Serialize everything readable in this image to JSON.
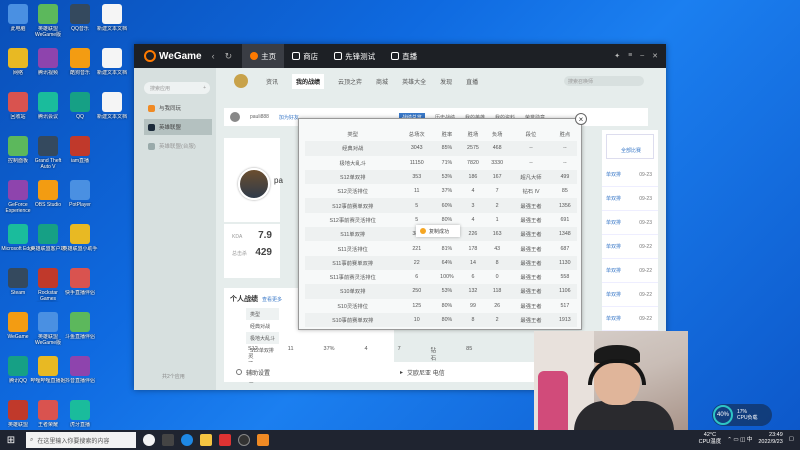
{
  "desktop": {
    "col1": [
      "此电脑",
      "网络",
      "回收站",
      "控制面板",
      "GeForce Experience",
      "Microsoft Edge",
      "Steam",
      "WeGame",
      "腾讯QQ",
      "英雄联盟"
    ],
    "col2": [
      "英雄联盟 WeGame版",
      "腾讯视频",
      "腾讯会议",
      "Grand Theft Auto V",
      "OBS Studio",
      "英雄联盟客户端",
      "Rockstar Games Launcher",
      "英雄联盟WeGame版",
      "哔哩哔哩直播姬",
      "王者荣耀"
    ],
    "col3": [
      "QQ音乐",
      "酷狗音乐",
      "QQ",
      "iam直播",
      "PotPlayer",
      "英雄联盟小助手",
      "快手直播伴侣",
      "斗鱼直播伴侣",
      "抖音直播伴侣",
      "虎牙直播"
    ],
    "col4": [
      "新建文本文档",
      "新建文本文档",
      "新建文本文档"
    ]
  },
  "wegame": {
    "logo": "WeGame",
    "nav": {
      "home": "主页",
      "store": "商店",
      "test": "先锋测试",
      "live": "直播"
    },
    "sidebar": {
      "search_placeholder": "搜索应用",
      "add": "+",
      "items": [
        "与我同玩",
        "英雄联盟",
        "英雄联盟(台服)"
      ],
      "footer": "共2个应用"
    },
    "game_tabs": [
      "资讯",
      "我的战绩",
      "云顶之弈",
      "商城",
      "英雄大全",
      "发现",
      "直播"
    ],
    "game_search_placeholder": "搜索召唤师",
    "sub_tabs": {
      "player": "pauli888",
      "fav": "加为好友",
      "items": [
        "战绩总览",
        "历史战绩",
        "我的英雄",
        "我的资料",
        "荣誉勋章"
      ]
    },
    "kda": [
      {
        "label": "KDA",
        "value": "7.9"
      },
      {
        "label": "总击杀",
        "value": "429"
      }
    ],
    "profile_name": "pa",
    "record": {
      "title": "个人战绩",
      "more": "查看更多",
      "header": "类型",
      "rows": [
        "经典对战",
        "极地大乱斗",
        "S12单双排"
      ],
      "last_row": [
        "S12灵活排位",
        "11",
        "37%",
        "4",
        "7",
        "钻石 IV",
        "85"
      ]
    },
    "rightlist": {
      "header": "全部比赛",
      "items": [
        {
          "mode": "单双排",
          "date": "09-23"
        },
        {
          "mode": "单双排",
          "date": "09-23"
        },
        {
          "mode": "单双排",
          "date": "09-23"
        },
        {
          "mode": "单双排",
          "date": "09-22"
        },
        {
          "mode": "单双排",
          "date": "09-22"
        },
        {
          "mode": "单双排",
          "date": "09-22"
        },
        {
          "mode": "单双排",
          "date": "09-22"
        },
        {
          "mode": "单双排",
          "date": "09-22"
        }
      ]
    },
    "footer": {
      "settings": "辅助设置",
      "voice": "艾欧尼亚 电信"
    }
  },
  "popup": {
    "columns": [
      "类型",
      "总场次",
      "胜率",
      "胜场",
      "负场",
      "段位",
      "胜点"
    ],
    "rows": [
      [
        "经典对战",
        "3043",
        "85%",
        "2575",
        "468",
        "--",
        "--"
      ],
      [
        "极地大乱斗",
        "11150",
        "71%",
        "7820",
        "3330",
        "--",
        "--"
      ],
      [
        "S12单双排",
        "353",
        "53%",
        "186",
        "167",
        "超凡大师",
        "499"
      ],
      [
        "S12灵活排位",
        "11",
        "37%",
        "4",
        "7",
        "钻石 IV",
        "85"
      ],
      [
        "S12事前赛单双排",
        "5",
        "60%",
        "3",
        "2",
        "最强王者",
        "1356"
      ],
      [
        "S12事前赛灵活排位",
        "5",
        "80%",
        "4",
        "1",
        "最强王者",
        "691"
      ],
      [
        "S11单双排",
        "389",
        "58%",
        "226",
        "163",
        "最强王者",
        "1348"
      ],
      [
        "S11灵活排位",
        "221",
        "81%",
        "178",
        "43",
        "最强王者",
        "687"
      ],
      [
        "S11事前赛单双排",
        "22",
        "64%",
        "14",
        "8",
        "最强王者",
        "1130"
      ],
      [
        "S11事前赛灵活排位",
        "6",
        "100%",
        "6",
        "0",
        "最强王者",
        "558"
      ],
      [
        "S10单双排",
        "250",
        "53%",
        "132",
        "118",
        "最强王者",
        "1106"
      ],
      [
        "S10灵活排位",
        "125",
        "80%",
        "99",
        "26",
        "最强王者",
        "517"
      ],
      [
        "S10事前赛单双排",
        "10",
        "80%",
        "8",
        "2",
        "最强王者",
        "1913"
      ]
    ],
    "close": "×",
    "toast": "复制成功"
  },
  "taskbar": {
    "search_placeholder": "在这里输入你要搜索的内容",
    "temp": "42°C",
    "temp_label": "CPU温度",
    "time": "23:49",
    "date": "2022/9/23"
  },
  "gauge": {
    "percent": "40%",
    "cpu": "17%",
    "cpu_label": "CPU负载"
  }
}
